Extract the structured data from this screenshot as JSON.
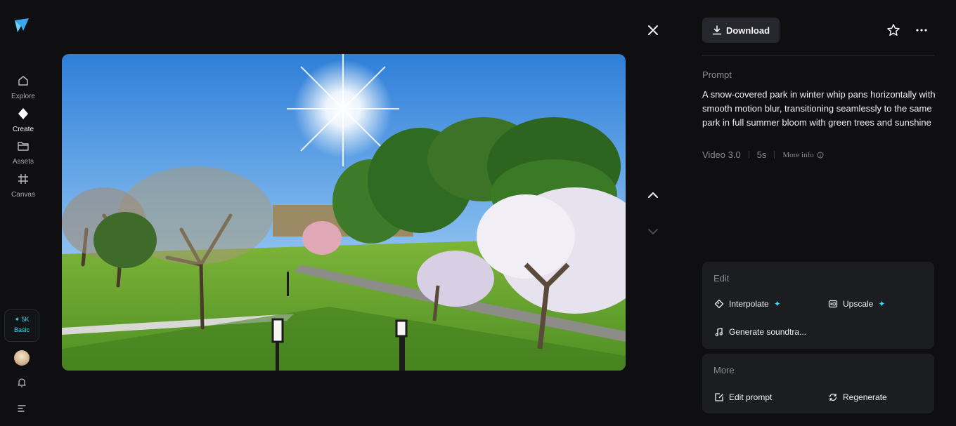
{
  "nav": {
    "items": [
      {
        "label": "Explore",
        "icon": "home-icon"
      },
      {
        "label": "Create",
        "icon": "diamond-icon"
      },
      {
        "label": "Assets",
        "icon": "folder-icon"
      },
      {
        "label": "Canvas",
        "icon": "grid-frame-icon"
      }
    ],
    "credits": {
      "amount": "✦ 5K",
      "tier": "Basic"
    }
  },
  "header": {
    "download_label": "Download"
  },
  "prompt": {
    "label": "Prompt",
    "text": "A snow-covered park in winter whip pans horizontally with smooth motion blur, transitioning seamlessly to the same park in full summer bloom with green trees and sunshine",
    "model": "Video 3.0",
    "duration": "5s",
    "more_info": "More info"
  },
  "edit": {
    "title": "Edit",
    "interpolate": "Interpolate",
    "upscale": "Upscale",
    "soundtrack": "Generate soundtra..."
  },
  "more": {
    "title": "More",
    "edit_prompt": "Edit prompt",
    "regenerate": "Regenerate"
  },
  "colors": {
    "accent": "#3fd8f0",
    "background": "#0f0f11",
    "card": "#1c1d21"
  }
}
